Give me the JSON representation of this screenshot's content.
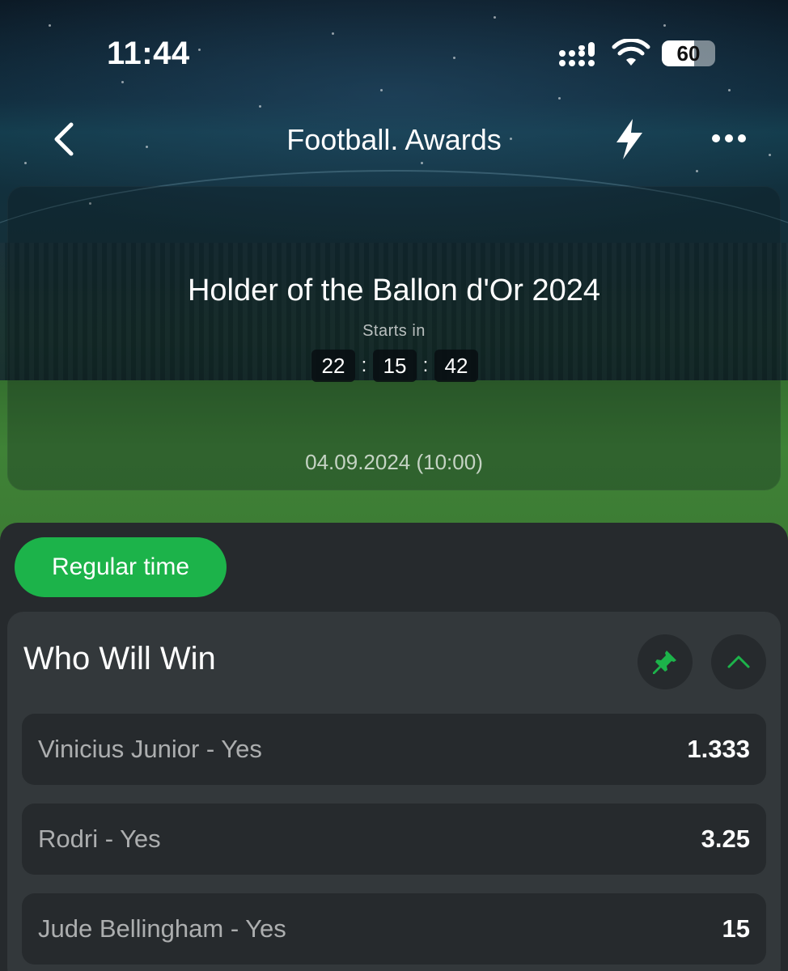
{
  "status_bar": {
    "time": "11:44",
    "battery": "60",
    "battery_level_percent": 60,
    "icons": [
      "signal-icon",
      "wifi-icon",
      "battery-icon"
    ]
  },
  "nav": {
    "title": "Football. Awards",
    "icons": [
      "back-chevron-icon",
      "lightning-icon",
      "more-dots-icon"
    ]
  },
  "event": {
    "title": "Holder of the Ballon d'Or 2024",
    "starts_label": "Starts in",
    "countdown": {
      "hours": "22",
      "minutes": "15",
      "seconds": "42",
      "separator": ":"
    },
    "date": "04.09.2024 (10:00)"
  },
  "tabs": [
    {
      "label": "Regular time",
      "active": true
    }
  ],
  "market": {
    "title": "Who Will Win",
    "icons": [
      "pin-icon",
      "chevron-up-icon"
    ],
    "outcomes": [
      {
        "label": "Vinicius Junior - Yes",
        "odds": "1.333"
      },
      {
        "label": "Rodri - Yes",
        "odds": "3.25"
      },
      {
        "label": "Jude Bellingham - Yes",
        "odds": "15"
      }
    ]
  },
  "colors": {
    "accent": "#1cb34a",
    "panel": "#262a2d",
    "card": "#33383b"
  }
}
